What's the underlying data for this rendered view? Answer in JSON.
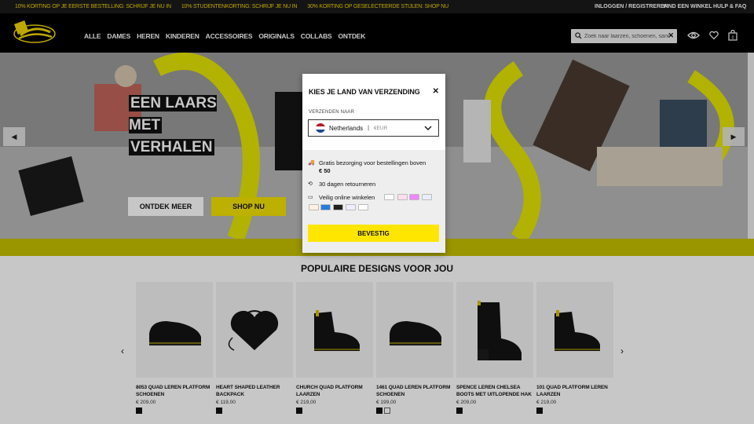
{
  "promo": {
    "messages": [
      "10% KORTING OP JE EERSTE BESTELLING: SCHRIJF JE NU IN",
      "10% STUDENTENKORTING: SCHRIJF JE NU IN",
      "30% KORTING OP GESELECTEERDE STIJLEN: SHOP NU"
    ],
    "login": "INLOGGEN / REGISTREREN",
    "store": "VIND EEN WINKEL",
    "help": "HULP & FAQ"
  },
  "header": {
    "nav": [
      "ALLE",
      "DAMES",
      "HEREN",
      "KINDEREN",
      "ACCESSOIRES",
      "ORIGINALS",
      "COLLABS",
      "ONTDEK"
    ],
    "search_placeholder": "Zoek naar laarzen, schoenen, sandalen"
  },
  "hero": {
    "title_line1": "EEN LAARS MET",
    "title_line2": "VERHALEN",
    "btn_more": "ONTDEK MEER",
    "btn_shop": "SHOP NU"
  },
  "popular": {
    "title": "POPULAIRE DESIGNS VOOR JOU",
    "products": [
      {
        "name": "8053 QUAD LEREN PLATFORM SCHOENEN",
        "price": "€ 209,00",
        "swatches": [
          "black"
        ]
      },
      {
        "name": "HEART SHAPED LEATHER BACKPACK",
        "price": "€ 119,00",
        "swatches": [
          "black"
        ]
      },
      {
        "name": "CHURCH QUAD PLATFORM LAARZEN",
        "price": "€ 219,00",
        "swatches": [
          "black"
        ]
      },
      {
        "name": "1461 QUAD LEREN PLATFORM SCHOENEN",
        "price": "€ 199,00",
        "swatches": [
          "black",
          "white"
        ]
      },
      {
        "name": "SPENCE LEREN CHELSEA BOOTS MET UITLOPENDE HAK",
        "price": "€ 209,00",
        "swatches": [
          "black"
        ]
      },
      {
        "name": "101 QUAD PLATFORM LEREN LAARZEN",
        "price": "€ 219,00",
        "swatches": [
          "black"
        ]
      }
    ]
  },
  "modal": {
    "title": "KIES JE LAND VAN VERZENDING",
    "label": "VERZENDEN NAAR",
    "country": "Netherlands",
    "separator": "|",
    "currency": "€EUR",
    "free_shipping": "Gratis bezorging voor bestellingen boven",
    "free_amount": "€ 50",
    "returns": "30 dagen retourneren",
    "safe_shopping": "Veilig online winkelen",
    "payment_methods": [
      "Apple Pay",
      "iDEAL",
      "Maestro",
      "Visa",
      "Mastercard",
      "Amex",
      "Bancontact",
      "PayPal",
      "Google Pay"
    ],
    "confirm": "BEVESTIG"
  },
  "colors": {
    "accent": "#ffe600",
    "header": "#000000",
    "promo_text": "#f2d600"
  }
}
